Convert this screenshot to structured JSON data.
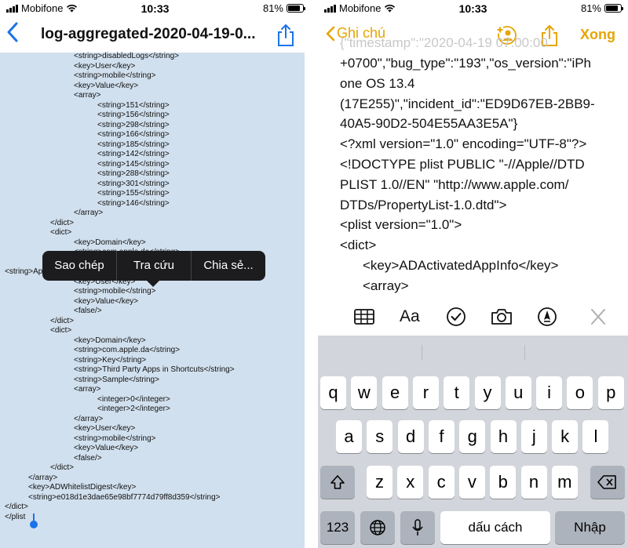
{
  "left": {
    "status": {
      "carrier": "Mobifone",
      "time": "10:33",
      "battery": "81%",
      "battery_level": 0.81
    },
    "nav": {
      "title": "log-aggregated-2020-04-19-0..."
    },
    "code_lines": [
      {
        "t": "<string>disabledLogs</string>",
        "i": 3
      },
      {
        "t": "<key>User</key>",
        "i": 3
      },
      {
        "t": "<string>mobile</string>",
        "i": 3
      },
      {
        "t": "<key>Value</key>",
        "i": 3
      },
      {
        "t": "<array>",
        "i": 3
      },
      {
        "t": "<string>151</string>",
        "i": 4
      },
      {
        "t": "<string>156</string>",
        "i": 4
      },
      {
        "t": "<string>298</string>",
        "i": 4
      },
      {
        "t": "<string>166</string>",
        "i": 4
      },
      {
        "t": "<string>185</string>",
        "i": 4
      },
      {
        "t": "<string>142</string>",
        "i": 4
      },
      {
        "t": "<string>145</string>",
        "i": 4
      },
      {
        "t": "<string>288</string>",
        "i": 4
      },
      {
        "t": "<string>301</string>",
        "i": 4
      },
      {
        "t": "<string>155</string>",
        "i": 4
      },
      {
        "t": "<string>146</string>",
        "i": 4
      },
      {
        "t": "</array>",
        "i": 3
      },
      {
        "t": "</dict>",
        "i": 2
      },
      {
        "t": "<dict>",
        "i": 2
      },
      {
        "t": "<key>Domain</key>",
        "i": 3
      },
      {
        "t": "<string>com.apple.da</string>",
        "i": 3
      },
      {
        "t": "",
        "i": 3
      },
      {
        "t": "<string>AppleEmbeddedOSOpenerInternalClientTelemetry</string>",
        "i": 0
      },
      {
        "t": "<key>User</key>",
        "i": 3
      },
      {
        "t": "<string>mobile</string>",
        "i": 3
      },
      {
        "t": "<key>Value</key>",
        "i": 3
      },
      {
        "t": "<false/>",
        "i": 3
      },
      {
        "t": "</dict>",
        "i": 2
      },
      {
        "t": "<dict>",
        "i": 2
      },
      {
        "t": "<key>Domain</key>",
        "i": 3
      },
      {
        "t": "<string>com.apple.da</string>",
        "i": 3
      },
      {
        "t": "<string>Key</string>",
        "i": 3
      },
      {
        "t": "<string>Third Party Apps in Shortcuts</string>",
        "i": 3
      },
      {
        "t": "<string>Sample</string>",
        "i": 3
      },
      {
        "t": "<array>",
        "i": 3
      },
      {
        "t": "<integer>0</integer>",
        "i": 4
      },
      {
        "t": "<integer>2</integer>",
        "i": 4
      },
      {
        "t": "</array>",
        "i": 3
      },
      {
        "t": "<key>User</key>",
        "i": 3
      },
      {
        "t": "<string>mobile</string>",
        "i": 3
      },
      {
        "t": "<key>Value</key>",
        "i": 3
      },
      {
        "t": "<false/>",
        "i": 3
      },
      {
        "t": "</dict>",
        "i": 2
      },
      {
        "t": "</array>",
        "i": 1
      },
      {
        "t": "<key>ADWhitelistDigest</key>",
        "i": 1
      },
      {
        "t": "<string>e018d1e3dae65e98bf7774d79ff8d359</string>",
        "i": 1
      },
      {
        "t": "</dict>",
        "i": 0
      },
      {
        "t": "</plist",
        "i": 0
      }
    ],
    "popup": {
      "copy": "Sao chép",
      "lookup": "Tra cứu",
      "share": "Chia sẻ..."
    }
  },
  "right": {
    "status": {
      "carrier": "Mobifone",
      "time": "10:33",
      "battery": "81%",
      "battery_level": 0.81
    },
    "nav": {
      "back_label": "Ghi chú",
      "done_label": "Xong"
    },
    "note_faded": "{\"timestamp\":\"2020-04-19 07:00:00",
    "note_lines": [
      {
        "t": "+0700\",\"bug_type\":\"193\",\"os_version\":\"iPh",
        "i": 0
      },
      {
        "t": "one OS 13.4",
        "i": 0
      },
      {
        "t": "(17E255)\",\"incident_id\":\"ED9D67EB-2BB9-",
        "i": 0
      },
      {
        "t": "40A5-90D2-504E55AA3E5A\"}",
        "i": 0
      },
      {
        "t": "<?xml version=\"1.0\" encoding=\"UTF-8\"?>",
        "i": 0
      },
      {
        "t": "<!DOCTYPE plist PUBLIC \"-//Apple//DTD",
        "i": 0
      },
      {
        "t": "PLIST 1.0//EN\" \"http://www.apple.com/",
        "i": 0
      },
      {
        "t": "DTDs/PropertyList-1.0.dtd\">",
        "i": 0
      },
      {
        "t": "<plist version=\"1.0\">",
        "i": 0
      },
      {
        "t": "<dict>",
        "i": 0
      },
      {
        "t": "<key>ADActivatedAppInfo</key>",
        "i": 1
      },
      {
        "t": "<array>",
        "i": 1
      }
    ],
    "format_icons": [
      "table-icon",
      "text-format-icon",
      "checklist-icon",
      "camera-icon",
      "markup-icon",
      "close-icon"
    ],
    "format_text_label": "Aa",
    "keyboard": {
      "row1": [
        "q",
        "w",
        "e",
        "r",
        "t",
        "y",
        "u",
        "i",
        "o",
        "p"
      ],
      "row2": [
        "a",
        "s",
        "d",
        "f",
        "g",
        "h",
        "j",
        "k",
        "l"
      ],
      "row3": [
        "z",
        "x",
        "c",
        "v",
        "b",
        "n",
        "m"
      ],
      "numbers_label": "123",
      "space_label": "dấu cách",
      "return_label": "Nhập"
    }
  }
}
